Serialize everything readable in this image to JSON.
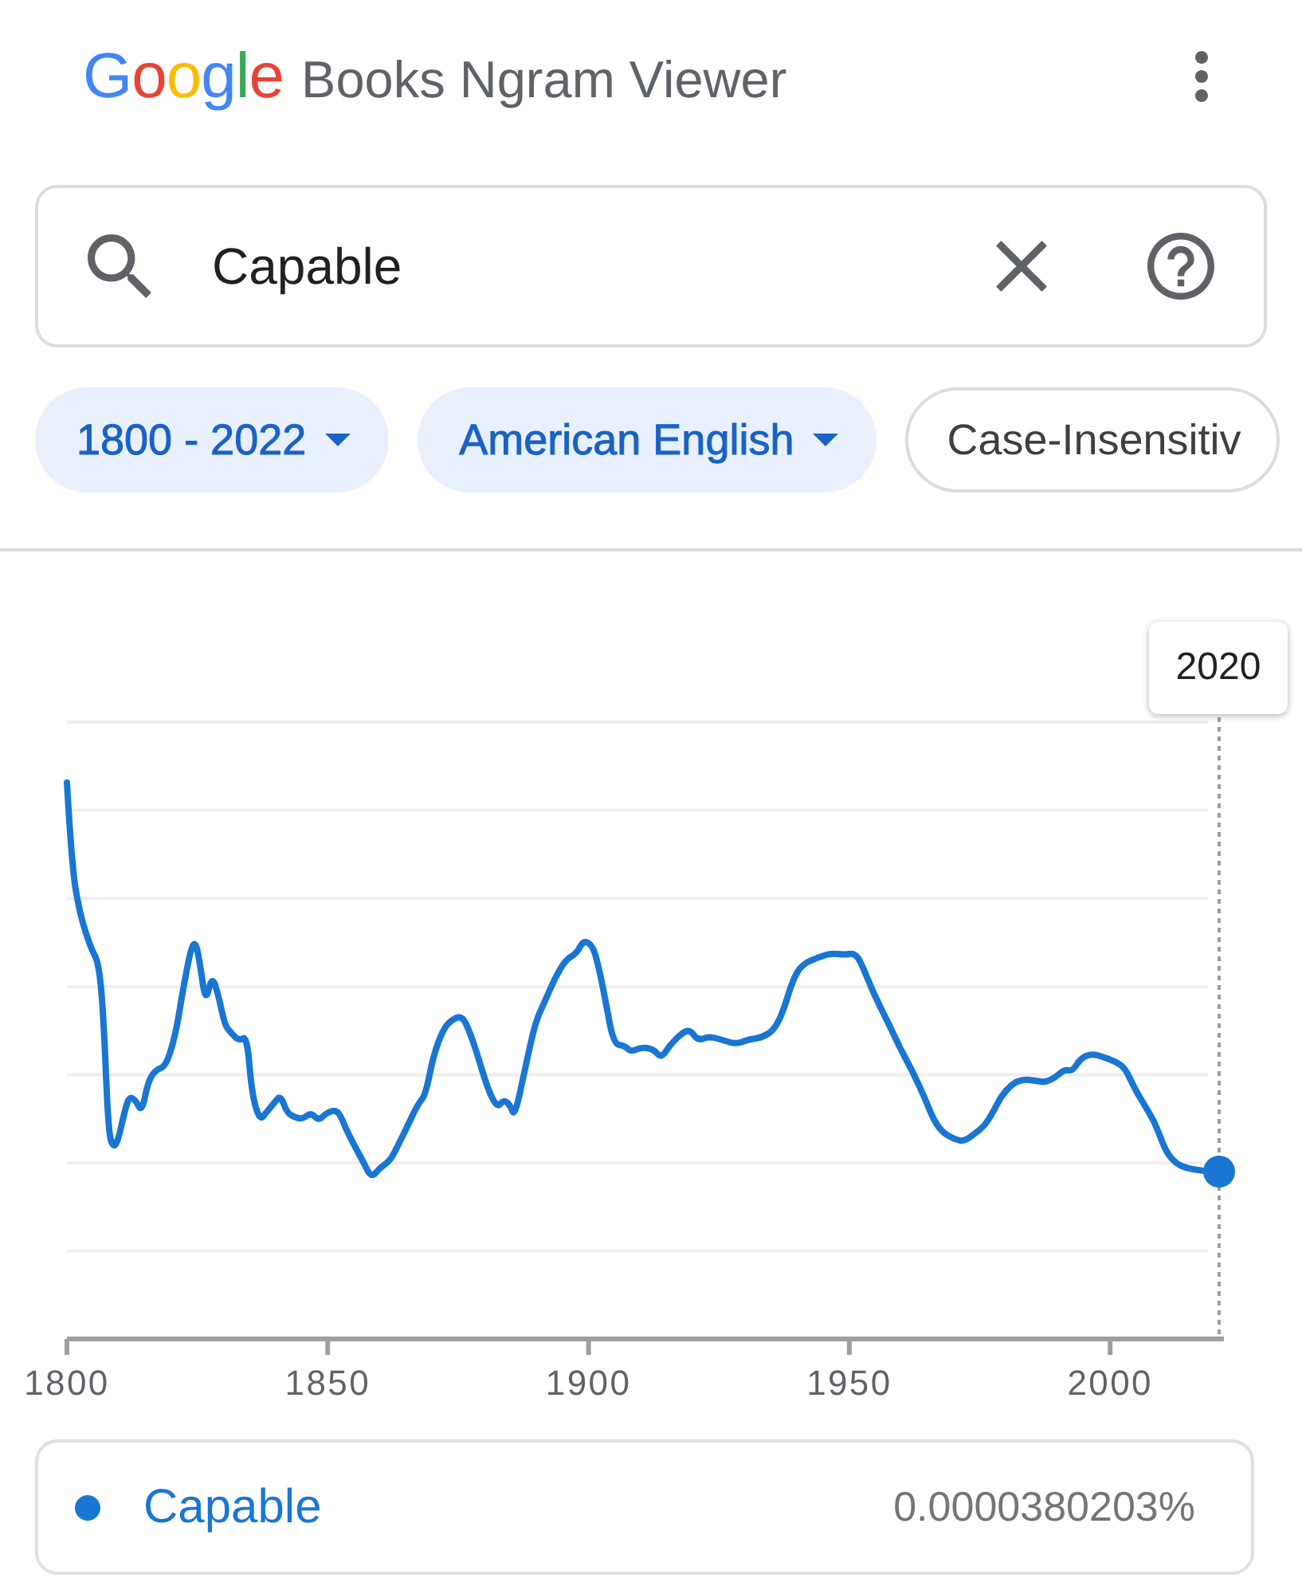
{
  "header": {
    "logo": "Google",
    "title": "Books Ngram Viewer"
  },
  "search": {
    "value": "Capable"
  },
  "filters": [
    {
      "label": "1800 - 2022",
      "kind": "dropdown",
      "selected": true
    },
    {
      "label": "American English",
      "kind": "dropdown",
      "selected": true
    },
    {
      "label": "Case-Insensitiv",
      "kind": "toggle",
      "selected": false
    }
  ],
  "chart": {
    "hover_year": "2020",
    "x_axis_labels": [
      "1800",
      "1850",
      "1900",
      "1950",
      "2000"
    ]
  },
  "legend": [
    {
      "name": "Capable",
      "value": "0.0000380203%",
      "color": "#1976d2"
    }
  ]
}
